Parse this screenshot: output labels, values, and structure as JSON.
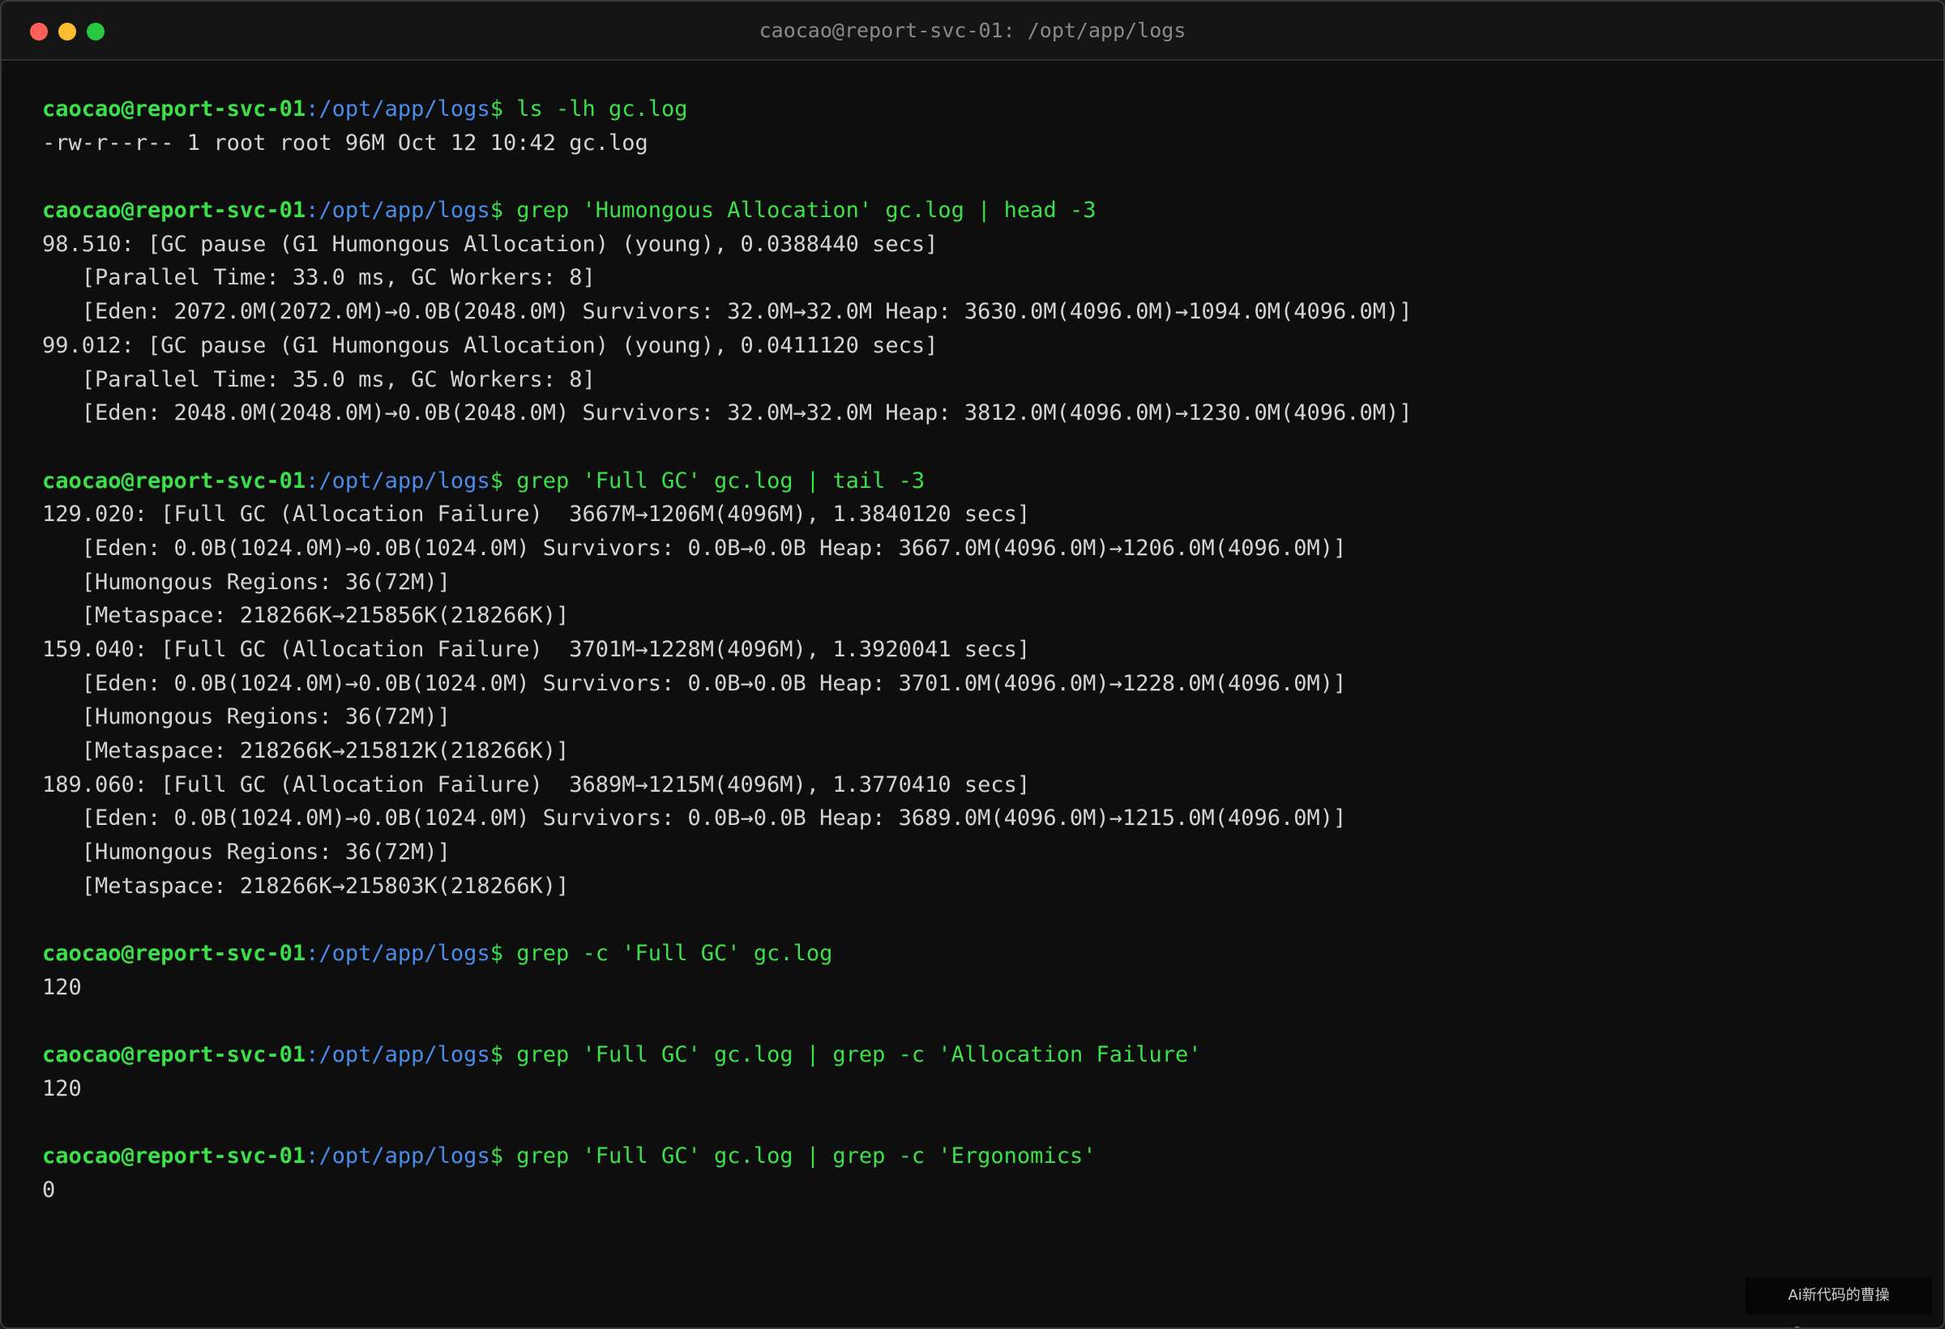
{
  "window": {
    "title": "caocao@report-svc-01: /opt/app/logs"
  },
  "prompt": {
    "user_host": "caocao@report-svc-01",
    "path_sep": ":",
    "path": "/opt/app/logs",
    "symbol": "$"
  },
  "blocks": [
    {
      "command": " ls -lh gc.log",
      "output": [
        "-rw-r--r-- 1 root root 96M Oct 12 10:42 gc.log"
      ]
    },
    {
      "command": " grep 'Humongous Allocation' gc.log | head -3",
      "output": [
        "98.510: [GC pause (G1 Humongous Allocation) (young), 0.0388440 secs]",
        "   [Parallel Time: 33.0 ms, GC Workers: 8]",
        "   [Eden: 2072.0M(2072.0M)→0.0B(2048.0M) Survivors: 32.0M→32.0M Heap: 3630.0M(4096.0M)→1094.0M(4096.0M)]",
        "99.012: [GC pause (G1 Humongous Allocation) (young), 0.0411120 secs]",
        "   [Parallel Time: 35.0 ms, GC Workers: 8]",
        "   [Eden: 2048.0M(2048.0M)→0.0B(2048.0M) Survivors: 32.0M→32.0M Heap: 3812.0M(4096.0M)→1230.0M(4096.0M)]"
      ]
    },
    {
      "command": " grep 'Full GC' gc.log | tail -3",
      "output": [
        "129.020: [Full GC (Allocation Failure)  3667M→1206M(4096M), 1.3840120 secs]",
        "   [Eden: 0.0B(1024.0M)→0.0B(1024.0M) Survivors: 0.0B→0.0B Heap: 3667.0M(4096.0M)→1206.0M(4096.0M)]",
        "   [Humongous Regions: 36(72M)]",
        "   [Metaspace: 218266K→215856K(218266K)]",
        "159.040: [Full GC (Allocation Failure)  3701M→1228M(4096M), 1.3920041 secs]",
        "   [Eden: 0.0B(1024.0M)→0.0B(1024.0M) Survivors: 0.0B→0.0B Heap: 3701.0M(4096.0M)→1228.0M(4096.0M)]",
        "   [Humongous Regions: 36(72M)]",
        "   [Metaspace: 218266K→215812K(218266K)]",
        "189.060: [Full GC (Allocation Failure)  3689M→1215M(4096M), 1.3770410 secs]",
        "   [Eden: 0.0B(1024.0M)→0.0B(1024.0M) Survivors: 0.0B→0.0B Heap: 3689.0M(4096.0M)→1215.0M(4096.0M)]",
        "   [Humongous Regions: 36(72M)]",
        "   [Metaspace: 218266K→215803K(218266K)]"
      ]
    },
    {
      "command": " grep -c 'Full GC' gc.log",
      "output": [
        "120"
      ]
    },
    {
      "command": " grep 'Full GC' gc.log | grep -c 'Allocation Failure'",
      "output": [
        "120"
      ]
    },
    {
      "command": " grep 'Full GC' gc.log | grep -c 'Ergonomics'",
      "output": [
        "0"
      ]
    }
  ],
  "watermark": "Ai新代码的曹操@opencao.cn",
  "colors": {
    "background": "#0e0e0e",
    "prompt_user": "#3ce04a",
    "prompt_path": "#4a8ce8",
    "command": "#3ce04a",
    "output": "#d4d4d4"
  }
}
